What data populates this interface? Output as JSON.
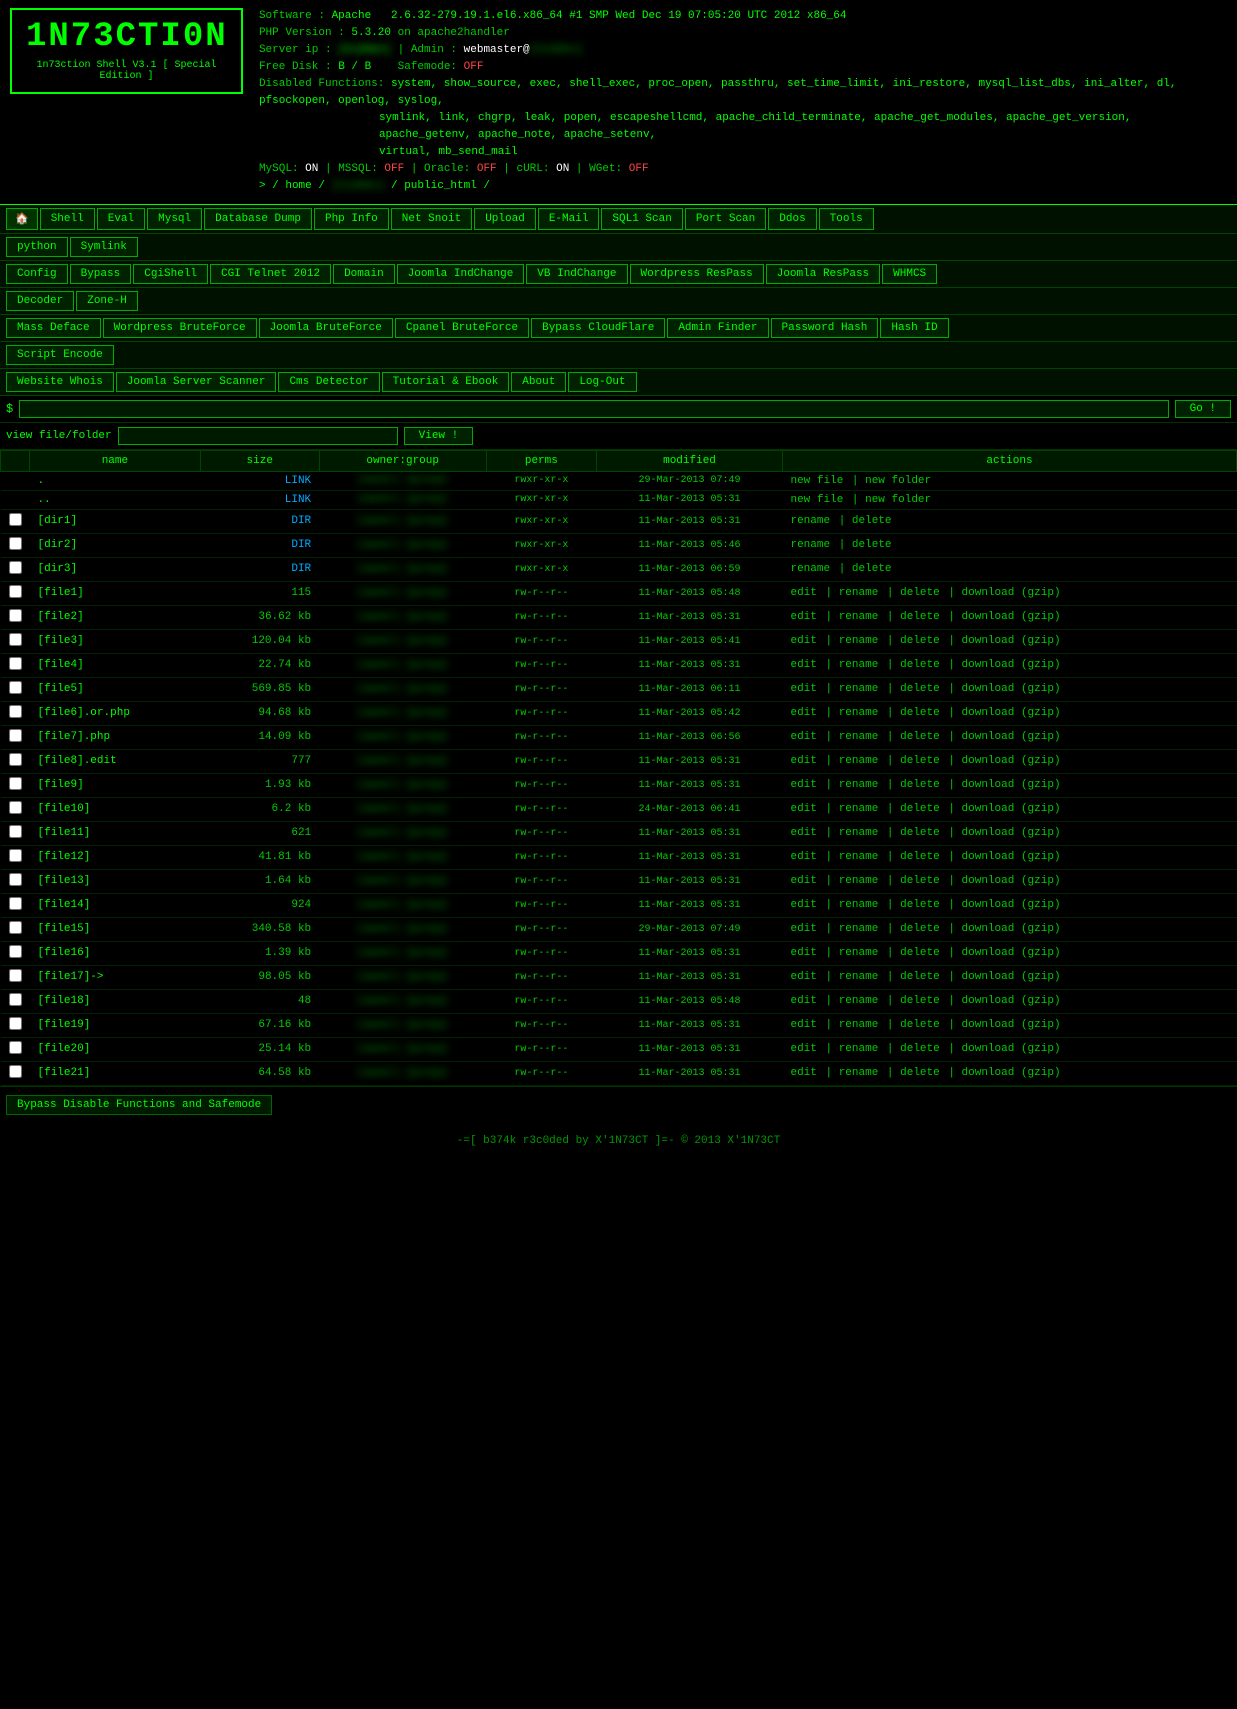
{
  "header": {
    "logo_text": "1N73CTI0N",
    "logo_sub": "1n73ction Shell V3.1 [ Special Edition ]",
    "sys": {
      "software_label": "Software :",
      "software_val": "Apache",
      "php_label": "PHP Version :",
      "php_val": "5.3.20",
      "php_extra": "on apache2handler",
      "server_label": "Server ip :",
      "server_val": "[hidden]",
      "admin_label": "Admin :",
      "admin_val": "webmaster@[hidden]",
      "freedisk_label": "Free Disk :",
      "freedisk_val": "B / B",
      "safemode_label": "Safemode:",
      "safemode_val": "OFF",
      "disabled_label": "Disabled Functions:",
      "disabled_val": "system, show_source, exec, shell_exec, proc_open, passthru, set_time_limit, ini_restore, mysql_list_dbs, ini_alter, dl, pfsockopen, openlog, syslog, symlink, link, chgrp, leak, popen, escapeshellcmd, apache_child_terminate, apache_get_modules, apache_get_version, apache_getenv, apache_note, apache_setenv, virtual, mb_send_mail",
      "mysql_label": "MySQL:",
      "mysql_val": "ON",
      "mssql_label": "MSSQL:",
      "mssql_val": "OFF",
      "oracle_label": "Oracle:",
      "oracle_val": "OFF",
      "curl_label": "cURL:",
      "curl_val": "ON",
      "wget_label": "WGet:",
      "wget_val": "OFF",
      "cwd_label": "> / home /",
      "cwd_val": "/ public_html /",
      "php_version_str": "2.6.32-279.19.1.el6.x86_64 #1 SMP Wed Dec 19 07:05:20 UTC 2012 x86_64"
    }
  },
  "nav": {
    "row1": [
      {
        "label": "🏠",
        "name": "home-btn"
      },
      {
        "label": "Shell",
        "name": "shell-btn"
      },
      {
        "label": "Eval",
        "name": "eval-btn"
      },
      {
        "label": "Mysql",
        "name": "mysql-btn"
      },
      {
        "label": "Database Dump",
        "name": "database-dump-btn"
      },
      {
        "label": "Php Info",
        "name": "php-info-btn"
      },
      {
        "label": "Net Snoit",
        "name": "net-snoit-btn"
      },
      {
        "label": "Upload",
        "name": "upload-btn"
      },
      {
        "label": "E-Mail",
        "name": "email-btn"
      },
      {
        "label": "SQL1 Scan",
        "name": "sql-scan-btn"
      },
      {
        "label": "Port Scan",
        "name": "port-scan-btn"
      },
      {
        "label": "Ddos",
        "name": "ddos-btn"
      },
      {
        "label": "Tools",
        "name": "tools-btn"
      }
    ],
    "row1b": [
      {
        "label": "python",
        "name": "python-btn"
      },
      {
        "label": "Symlink",
        "name": "symlink-btn"
      }
    ],
    "row2": [
      {
        "label": "Config",
        "name": "config-btn"
      },
      {
        "label": "Bypass",
        "name": "bypass-btn"
      },
      {
        "label": "CgiShell",
        "name": "cgishell-btn"
      },
      {
        "label": "CGI Telnet 2012",
        "name": "cgi-telnet-btn"
      },
      {
        "label": "Domain",
        "name": "domain-btn"
      },
      {
        "label": "Joomla IndChange",
        "name": "joomla-indchange-btn"
      },
      {
        "label": "VB IndChange",
        "name": "vb-indchange-btn"
      },
      {
        "label": "Wordpress ResPass",
        "name": "wp-respass-btn"
      },
      {
        "label": "Joomla ResPass",
        "name": "joomla-respass-btn"
      },
      {
        "label": "WHMCS",
        "name": "whmcs-btn"
      }
    ],
    "row2b": [
      {
        "label": "Decoder",
        "name": "decoder-btn"
      },
      {
        "label": "Zone-H",
        "name": "zone-h-btn"
      }
    ],
    "row3": [
      {
        "label": "Mass Deface",
        "name": "mass-deface-btn"
      },
      {
        "label": "Wordpress BruteForce",
        "name": "wp-brute-btn"
      },
      {
        "label": "Joomla BruteForce",
        "name": "joomla-brute-btn"
      },
      {
        "label": "Cpanel BruteForce",
        "name": "cpanel-brute-btn"
      },
      {
        "label": "Bypass CloudFlare",
        "name": "bypass-cf-btn"
      },
      {
        "label": "Admin Finder",
        "name": "admin-finder-btn"
      },
      {
        "label": "Password Hash",
        "name": "password-hash-btn"
      },
      {
        "label": "Hash ID",
        "name": "hash-id-btn"
      }
    ],
    "row3b": [
      {
        "label": "Script Encode",
        "name": "script-encode-btn"
      }
    ],
    "row4": [
      {
        "label": "Website Whois",
        "name": "whois-btn"
      },
      {
        "label": "Joomla Server Scanner",
        "name": "joomla-scanner-btn"
      },
      {
        "label": "Cms Detector",
        "name": "cms-detector-btn"
      },
      {
        "label": "Tutorial & Ebook",
        "name": "tutorial-btn"
      },
      {
        "label": "About",
        "name": "about-btn"
      },
      {
        "label": "Log-Out",
        "name": "logout-btn"
      }
    ]
  },
  "cmd_row": {
    "label": "$",
    "placeholder": "",
    "go_label": "Go !"
  },
  "view_row": {
    "label": "view file/folder",
    "placeholder": "",
    "view_label": "View !"
  },
  "table": {
    "headers": [
      "",
      "name",
      "size",
      "owner:group",
      "perms",
      "modified",
      "actions"
    ],
    "rows": [
      {
        "cb": false,
        "name": ".",
        "size": "LINK",
        "owner": "",
        "perms": "rwxr-xr-x",
        "modified": "29-Mar-2013 07:49",
        "actions": [
          "new file",
          "new folder"
        ],
        "type": "link"
      },
      {
        "cb": false,
        "name": "..",
        "size": "LINK",
        "owner": "",
        "perms": "rwxr-xr-x",
        "modified": "11-Mar-2013 05:31",
        "actions": [
          "new file",
          "new folder"
        ],
        "type": "link"
      },
      {
        "cb": true,
        "name": "[dir1]",
        "size": "DIR",
        "owner": "",
        "perms": "rwxr-xr-x",
        "modified": "11-Mar-2013 05:31",
        "actions": [
          "rename",
          "delete"
        ],
        "type": "dir"
      },
      {
        "cb": true,
        "name": "[dir2]",
        "size": "DIR",
        "owner": "",
        "perms": "rwxr-xr-x",
        "modified": "11-Mar-2013 05:46",
        "actions": [
          "rename",
          "delete"
        ],
        "type": "dir"
      },
      {
        "cb": true,
        "name": "[dir3]",
        "size": "DIR",
        "owner": "",
        "perms": "rwxr-xr-x",
        "modified": "11-Mar-2013 06:59",
        "actions": [
          "rename",
          "delete"
        ],
        "type": "dir"
      },
      {
        "cb": true,
        "name": "[file1]",
        "size": "115",
        "owner": "",
        "perms": "rw-r--r--",
        "modified": "11-Mar-2013 05:48",
        "actions": [
          "edit",
          "rename",
          "delete",
          "download (gzip)"
        ],
        "type": "file"
      },
      {
        "cb": true,
        "name": "[file2]",
        "size": "36.62 kb",
        "owner": "",
        "perms": "rw-r--r--",
        "modified": "11-Mar-2013 05:31",
        "actions": [
          "edit",
          "rename",
          "delete",
          "download (gzip)"
        ],
        "type": "file"
      },
      {
        "cb": true,
        "name": "[file3]",
        "size": "120.04 kb",
        "owner": "",
        "perms": "rw-r--r--",
        "modified": "11-Mar-2013 05:41",
        "actions": [
          "edit",
          "rename",
          "delete",
          "download (gzip)"
        ],
        "type": "file"
      },
      {
        "cb": true,
        "name": "[file4]",
        "size": "22.74 kb",
        "owner": "",
        "perms": "rw-r--r--",
        "modified": "11-Mar-2013 05:31",
        "actions": [
          "edit",
          "rename",
          "delete",
          "download (gzip)"
        ],
        "type": "file"
      },
      {
        "cb": true,
        "name": "[file5]",
        "size": "569.85 kb",
        "owner": "",
        "perms": "rw-r--r--",
        "modified": "11-Mar-2013 06:11",
        "actions": [
          "edit",
          "rename",
          "delete",
          "download (gzip)"
        ],
        "type": "file"
      },
      {
        "cb": true,
        "name": "[file6].or.php",
        "size": "94.68 kb",
        "owner": "",
        "perms": "rw-r--r--",
        "modified": "11-Mar-2013 05:42",
        "actions": [
          "edit",
          "rename",
          "delete",
          "download (gzip)"
        ],
        "type": "file"
      },
      {
        "cb": true,
        "name": "[file7].php",
        "size": "14.09 kb",
        "owner": "",
        "perms": "rw-r--r--",
        "modified": "11-Mar-2013 06:56",
        "actions": [
          "edit",
          "rename",
          "delete",
          "download (gzip)"
        ],
        "type": "file"
      },
      {
        "cb": true,
        "name": "[file8].edit",
        "size": "777",
        "owner": "",
        "perms": "rw-r--r--",
        "modified": "11-Mar-2013 05:31",
        "actions": [
          "edit",
          "rename",
          "delete",
          "download (gzip)"
        ],
        "type": "file"
      },
      {
        "cb": true,
        "name": "[file9]",
        "size": "1.93 kb",
        "owner": "",
        "perms": "rw-r--r--",
        "modified": "11-Mar-2013 05:31",
        "actions": [
          "edit",
          "rename",
          "delete",
          "download (gzip)"
        ],
        "type": "file"
      },
      {
        "cb": true,
        "name": "[file10]",
        "size": "6.2 kb",
        "owner": "",
        "perms": "rw-r--r--",
        "modified": "24-Mar-2013 06:41",
        "actions": [
          "edit",
          "rename",
          "delete",
          "download (gzip)"
        ],
        "type": "file"
      },
      {
        "cb": true,
        "name": "[file11]",
        "size": "621",
        "owner": "",
        "perms": "rw-r--r--",
        "modified": "11-Mar-2013 05:31",
        "actions": [
          "edit",
          "rename",
          "delete",
          "download (gzip)"
        ],
        "type": "file"
      },
      {
        "cb": true,
        "name": "[file12]",
        "size": "41.81 kb",
        "owner": "",
        "perms": "rw-r--r--",
        "modified": "11-Mar-2013 05:31",
        "actions": [
          "edit",
          "rename",
          "delete",
          "download (gzip)"
        ],
        "type": "file"
      },
      {
        "cb": true,
        "name": "[file13]",
        "size": "1.64 kb",
        "owner": "",
        "perms": "rw-r--r--",
        "modified": "11-Mar-2013 05:31",
        "actions": [
          "edit",
          "rename",
          "delete",
          "download (gzip)"
        ],
        "type": "file"
      },
      {
        "cb": true,
        "name": "[file14]",
        "size": "924",
        "owner": "",
        "perms": "rw-r--r--",
        "modified": "11-Mar-2013 05:31",
        "actions": [
          "edit",
          "rename",
          "delete",
          "download (gzip)"
        ],
        "type": "file"
      },
      {
        "cb": true,
        "name": "[file15]",
        "size": "340.58 kb",
        "owner": "",
        "perms": "rw-r--r--",
        "modified": "29-Mar-2013 07:49",
        "actions": [
          "edit",
          "rename",
          "delete",
          "download (gzip)"
        ],
        "type": "file"
      },
      {
        "cb": true,
        "name": "[file16]",
        "size": "1.39 kb",
        "owner": "",
        "perms": "rw-r--r--",
        "modified": "11-Mar-2013 05:31",
        "actions": [
          "edit",
          "rename",
          "delete",
          "download (gzip)"
        ],
        "type": "file"
      },
      {
        "cb": true,
        "name": "[file17]->",
        "size": "98.05 kb",
        "owner": "",
        "perms": "rw-r--r--",
        "modified": "11-Mar-2013 05:31",
        "actions": [
          "edit",
          "rename",
          "delete",
          "download (gzip)"
        ],
        "type": "file"
      },
      {
        "cb": true,
        "name": "[file18]",
        "size": "48",
        "owner": "",
        "perms": "rw-r--r--",
        "modified": "11-Mar-2013 05:48",
        "actions": [
          "edit",
          "rename",
          "delete",
          "download (gzip)"
        ],
        "type": "file"
      },
      {
        "cb": true,
        "name": "[file19]",
        "size": "67.16 kb",
        "owner": "",
        "perms": "rw-r--r--",
        "modified": "11-Mar-2013 05:31",
        "actions": [
          "edit",
          "rename",
          "delete",
          "download (gzip)"
        ],
        "type": "file"
      },
      {
        "cb": true,
        "name": "[file20]",
        "size": "25.14 kb",
        "owner": "",
        "perms": "rw-r--r--",
        "modified": "11-Mar-2013 05:31",
        "actions": [
          "edit",
          "rename",
          "delete",
          "download (gzip)"
        ],
        "type": "file"
      },
      {
        "cb": true,
        "name": "[file21]",
        "size": "64.58 kb",
        "owner": "",
        "perms": "rw-r--r--",
        "modified": "11-Mar-2013 05:31",
        "actions": [
          "edit",
          "rename",
          "delete",
          "download (gzip)"
        ],
        "type": "file"
      }
    ]
  },
  "footer": {
    "bypass_btn": "Bypass Disable Functions and Safemode",
    "credit": "-=[ b374k r3c0ded by X'1N73CT ]=- © 2013 X'1N73CT"
  }
}
